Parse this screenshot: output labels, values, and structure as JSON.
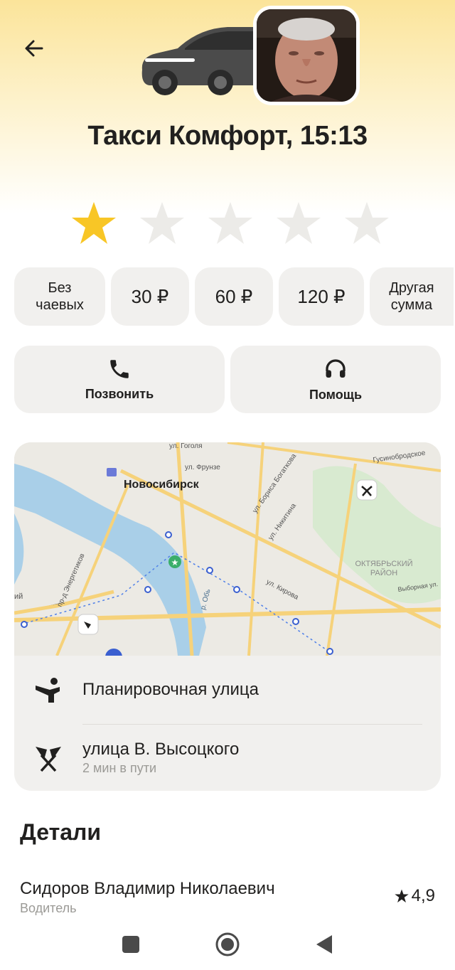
{
  "header": {
    "title": "Такси Комфорт, 15:13"
  },
  "rating": {
    "value": 1,
    "max": 5,
    "filled_color": "#f8c626",
    "empty_color": "#ecebe8"
  },
  "tips": {
    "options": [
      {
        "line1": "Без",
        "line2": "чаевых"
      },
      {
        "line1": "30 ₽"
      },
      {
        "line1": "60 ₽"
      },
      {
        "line1": "120 ₽"
      },
      {
        "line1": "Другая",
        "line2": "сумма"
      }
    ]
  },
  "actions": {
    "call_label": "Позвонить",
    "help_label": "Помощь"
  },
  "map": {
    "city_label": "Новосибирск",
    "district_line1": "ОКТЯБРЬСКИЙ",
    "district_line2": "РАЙОН",
    "streets": {
      "gogolya": "ул. Гоголя",
      "frunze": "ул. Фрунзе",
      "gusinobrodskoe": "Гусинобродское",
      "bogatkova": "ул. Бориса Богаткова",
      "nikitina": "ул. Никитина",
      "energetikov": "пр-д Энергетиков",
      "kirova": "ул. Кирова",
      "vybornaya": "Выборная ул.",
      "ob": "р. Обь",
      "edge": "ий"
    }
  },
  "route": {
    "from": "Планировочная улица",
    "to": "улица В. Высоцкого",
    "to_eta": "2 мин в пути"
  },
  "details": {
    "heading": "Детали",
    "driver_name": "Сидоров Владимир Николаевич",
    "driver_role": "Водитель",
    "driver_rating": "4,9"
  },
  "icons": {
    "back": "arrow-left-icon",
    "call": "phone-icon",
    "help": "headset-icon",
    "from": "person-waving-icon",
    "to": "checkered-flags-icon",
    "nav_recents": "square-icon",
    "nav_home": "circle-icon",
    "nav_back": "triangle-icon"
  }
}
